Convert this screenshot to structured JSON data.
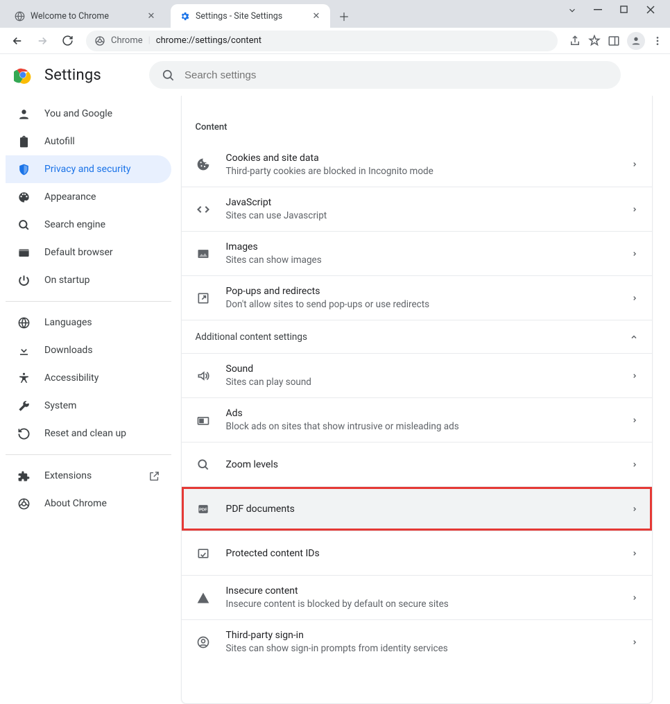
{
  "window": {
    "tabs": [
      {
        "title": "Welcome to Chrome",
        "active": false
      },
      {
        "title": "Settings - Site Settings",
        "active": true
      }
    ]
  },
  "omnibox": {
    "scheme_label": "Chrome",
    "url_display": "chrome://settings/content"
  },
  "settings": {
    "title": "Settings",
    "search_placeholder": "Search settings"
  },
  "sidebar": {
    "groups": [
      [
        {
          "key": "you",
          "label": "You and Google",
          "icon": "person"
        },
        {
          "key": "autofill",
          "label": "Autofill",
          "icon": "clipboard"
        },
        {
          "key": "privacy",
          "label": "Privacy and security",
          "icon": "shield",
          "active": true
        },
        {
          "key": "appearance",
          "label": "Appearance",
          "icon": "palette"
        },
        {
          "key": "search",
          "label": "Search engine",
          "icon": "search"
        },
        {
          "key": "default",
          "label": "Default browser",
          "icon": "browser"
        },
        {
          "key": "startup",
          "label": "On startup",
          "icon": "power"
        }
      ],
      [
        {
          "key": "languages",
          "label": "Languages",
          "icon": "globe"
        },
        {
          "key": "downloads",
          "label": "Downloads",
          "icon": "download"
        },
        {
          "key": "accessibility",
          "label": "Accessibility",
          "icon": "accessibility"
        },
        {
          "key": "system",
          "label": "System",
          "icon": "wrench"
        },
        {
          "key": "reset",
          "label": "Reset and clean up",
          "icon": "restore"
        }
      ],
      [
        {
          "key": "extensions",
          "label": "Extensions",
          "icon": "extension",
          "external": true
        },
        {
          "key": "about",
          "label": "About Chrome",
          "icon": "chrome"
        }
      ]
    ]
  },
  "content": {
    "section_label": "Content",
    "items": [
      {
        "key": "cookies",
        "icon": "cookie",
        "title": "Cookies and site data",
        "sub": "Third-party cookies are blocked in Incognito mode"
      },
      {
        "key": "javascript",
        "icon": "code",
        "title": "JavaScript",
        "sub": "Sites can use Javascript"
      },
      {
        "key": "images",
        "icon": "image",
        "title": "Images",
        "sub": "Sites can show images"
      },
      {
        "key": "popups",
        "icon": "popup",
        "title": "Pop-ups and redirects",
        "sub": "Don't allow sites to send pop-ups or use redirects"
      }
    ],
    "additional_label": "Additional content settings",
    "additional_items": [
      {
        "key": "sound",
        "icon": "sound",
        "title": "Sound",
        "sub": "Sites can play sound"
      },
      {
        "key": "ads",
        "icon": "ads",
        "title": "Ads",
        "sub": "Block ads on sites that show intrusive or misleading ads"
      },
      {
        "key": "zoom",
        "icon": "zoom",
        "title": "Zoom levels",
        "sub": ""
      },
      {
        "key": "pdf",
        "icon": "pdf",
        "title": "PDF documents",
        "sub": "",
        "highlight": true
      },
      {
        "key": "protected",
        "icon": "protected",
        "title": "Protected content IDs",
        "sub": ""
      },
      {
        "key": "insecure",
        "icon": "warning",
        "title": "Insecure content",
        "sub": "Insecure content is blocked by default on secure sites"
      },
      {
        "key": "thirdparty",
        "icon": "usercircle",
        "title": "Third-party sign-in",
        "sub": "Sites can show sign-in prompts from identity services"
      }
    ]
  }
}
